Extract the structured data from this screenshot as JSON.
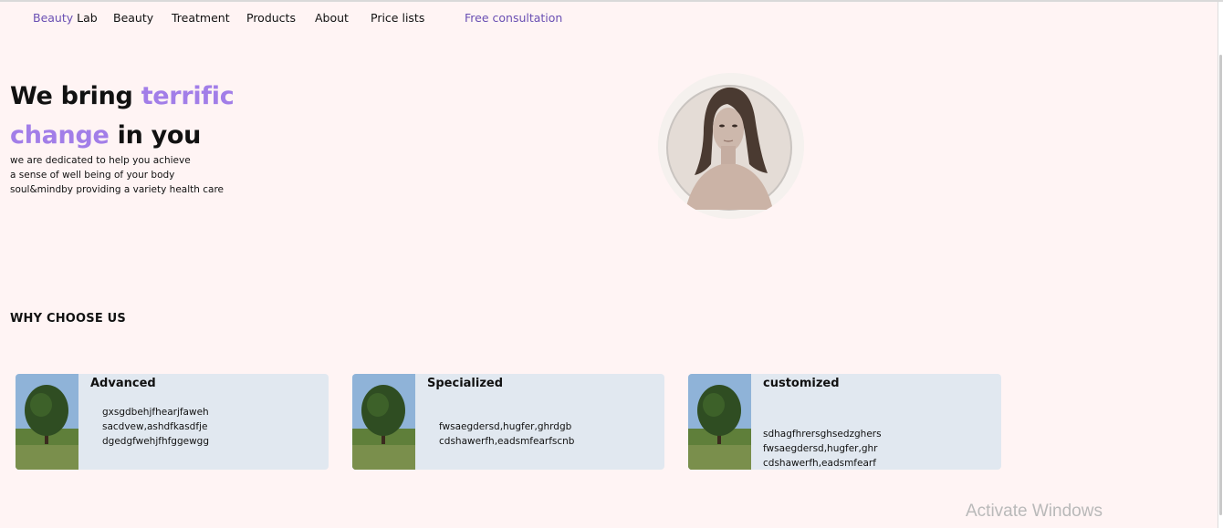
{
  "nav": {
    "brand_first": "Beauty",
    "brand_second": " Lab",
    "items": [
      "Beauty",
      "Treatment",
      "Products",
      "About",
      "Price lists"
    ],
    "cta": "Free consultation"
  },
  "hero": {
    "title_part1": "We bring ",
    "title_accent1": "terrific",
    "title_accent2": "change",
    "title_part2": " in you",
    "desc_lines": [
      "we are dedicated to help you achieve",
      "a sense of well being of your body",
      "soul&mindby providing a variety health care"
    ]
  },
  "section": {
    "heading": "WHY CHOOSE US"
  },
  "cards": [
    {
      "title": "Advanced",
      "lines": [
        "gxsgdbehjfhearjfaweh",
        "sacdvew,ashdfkasdfje",
        "dgedgfwehjfhfggewgg"
      ]
    },
    {
      "title": "Specialized",
      "lines": [
        "fwsaegdersd,hugfer,ghrdgb",
        "cdshawerfh,eadsmfearfscnb"
      ]
    },
    {
      "title": "customized",
      "lines": [
        "sdhagfhrersghsedzghers",
        "fwsaegdersd,hugfer,ghr",
        "cdshawerfh,eadsmfearf"
      ]
    }
  ],
  "watermark": "Activate Windows",
  "colors": {
    "background": "#fff4f4",
    "accent": "#a27ee8",
    "nav_accent": "#6a4fb3",
    "card_bg": "#e1e8f0"
  }
}
